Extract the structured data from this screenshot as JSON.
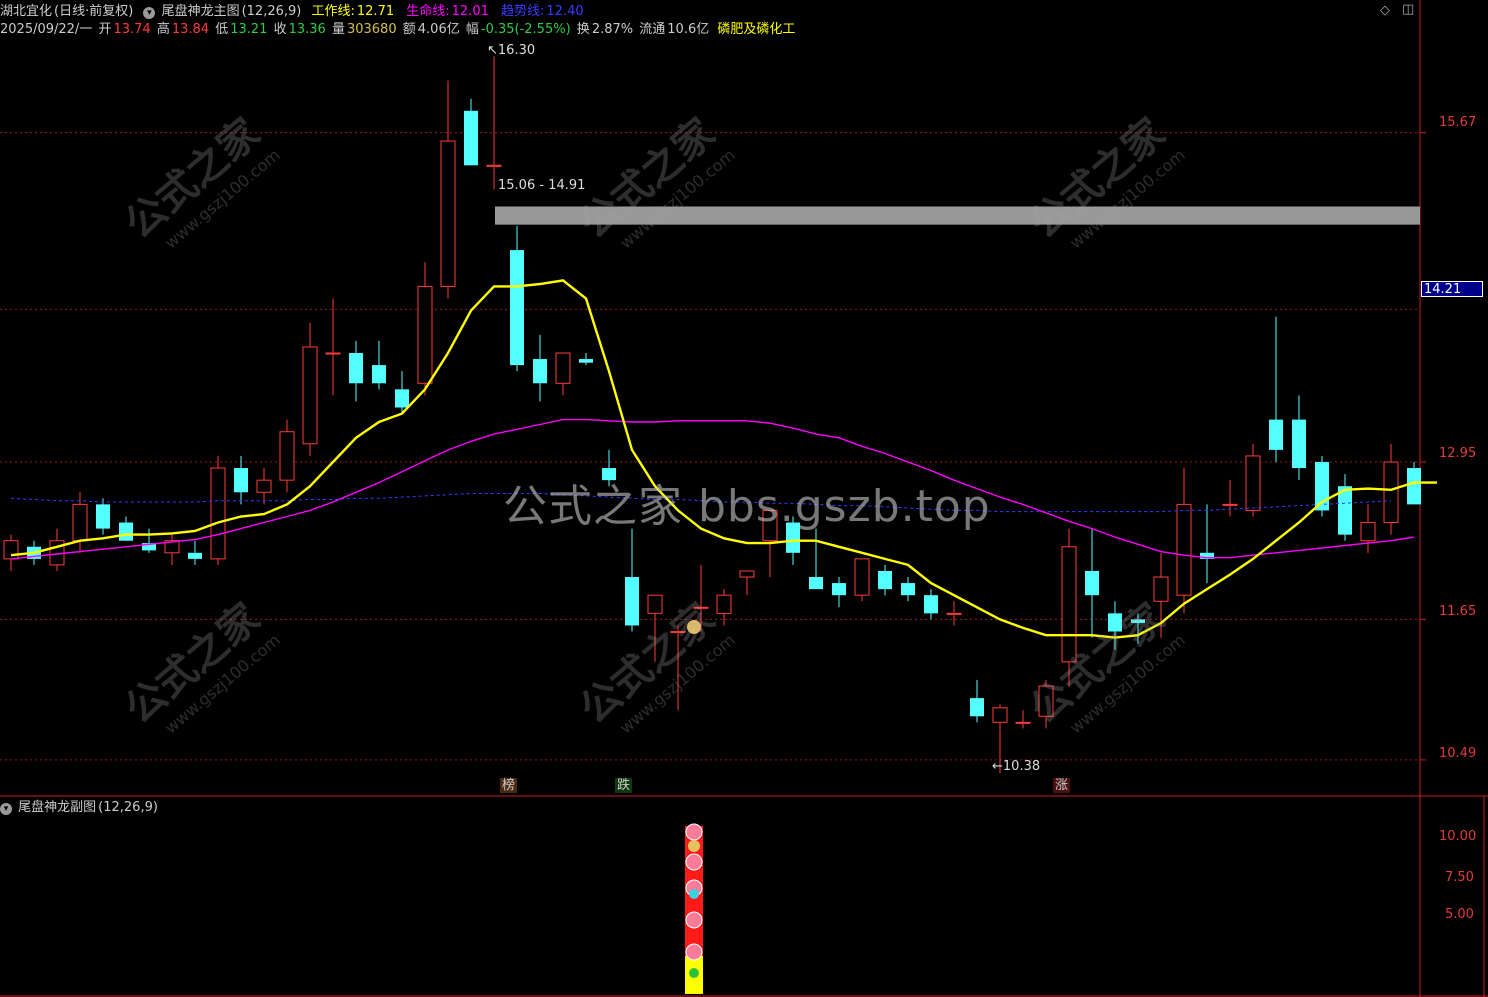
{
  "header": {
    "stock_name": "湖北宜化",
    "period": "(日线·前复权)",
    "indicator_name": "尾盘神龙主图",
    "indicator_params": "(12,26,9)",
    "work_line_label": "工作线:",
    "work_line_value": "12.71",
    "life_line_label": "生命线:",
    "life_line_value": "12.01",
    "trend_line_label": "趋势线:",
    "trend_line_value": "12.40",
    "date": "2025/09/22/一",
    "open_label": "开",
    "open_value": "13.74",
    "high_label": "高",
    "high_value": "13.84",
    "low_label": "低",
    "low_value": "13.21",
    "close_label": "收",
    "close_value": "13.36",
    "volume_label": "量",
    "volume_value": "303680",
    "amount_label": "额",
    "amount_value": "4.06亿",
    "change_label": "幅",
    "change_value": "-0.35(-2.55%)",
    "turnover_label": "换",
    "turnover_value": "2.87%",
    "float_label": "流通",
    "float_value": "10.6亿",
    "sector": "磷肥及磷化工"
  },
  "toolbar": {
    "diamond_icon": "diamond-icon",
    "panel_icon": "panel-toggle-icon"
  },
  "y_axis": {
    "labels": [
      "15.67",
      "12.95",
      "11.65",
      "10.49"
    ],
    "current_price": "14.21"
  },
  "sub_panel": {
    "title": "尾盘神龙副图",
    "params": "(12,26,9)",
    "y_labels": [
      "10.00",
      "7.50",
      "5.00"
    ]
  },
  "annotations": {
    "high_mark": "16.30",
    "low_mark": "10.38",
    "range_label": "15.06 - 14.91"
  },
  "flags": [
    {
      "text": "榜",
      "color": "#d2691e"
    },
    {
      "text": "跌",
      "color": "#2ecc40"
    },
    {
      "text": "涨",
      "color": "#e03c3c"
    }
  ],
  "watermark": {
    "main": "公式之家 bbs.gszb.top",
    "tile_cn": "公式之家",
    "tile_url": "www.gszj100.com"
  },
  "colors": {
    "up": "#ff3b3b",
    "down": "#54ffff",
    "work_line": "#ffff00",
    "life_line": "#ff00ff",
    "trend_line": "#3b3bff",
    "grid": "#a01818",
    "axis": "#c81e1e"
  },
  "chart_data": {
    "type": "candlestick",
    "ylim": [
      10.2,
      16.6
    ],
    "candles": [
      {
        "o": 12.15,
        "h": 12.35,
        "l": 12.05,
        "c": 12.3
      },
      {
        "o": 12.25,
        "h": 12.3,
        "l": 12.1,
        "c": 12.15
      },
      {
        "o": 12.1,
        "h": 12.4,
        "l": 12.05,
        "c": 12.3
      },
      {
        "o": 12.3,
        "h": 12.7,
        "l": 12.2,
        "c": 12.6
      },
      {
        "o": 12.6,
        "h": 12.65,
        "l": 12.35,
        "c": 12.4
      },
      {
        "o": 12.45,
        "h": 12.5,
        "l": 12.3,
        "c": 12.3
      },
      {
        "o": 12.28,
        "h": 12.4,
        "l": 12.2,
        "c": 12.22
      },
      {
        "o": 12.2,
        "h": 12.35,
        "l": 12.1,
        "c": 12.3
      },
      {
        "o": 12.2,
        "h": 12.3,
        "l": 12.1,
        "c": 12.15
      },
      {
        "o": 12.15,
        "h": 13.0,
        "l": 12.1,
        "c": 12.9
      },
      {
        "o": 12.9,
        "h": 13.0,
        "l": 12.6,
        "c": 12.7
      },
      {
        "o": 12.7,
        "h": 12.9,
        "l": 12.6,
        "c": 12.8
      },
      {
        "o": 12.8,
        "h": 13.3,
        "l": 12.7,
        "c": 13.2
      },
      {
        "o": 13.1,
        "h": 14.1,
        "l": 13.0,
        "c": 13.9
      },
      {
        "o": 13.85,
        "h": 14.3,
        "l": 13.5,
        "c": 13.85
      },
      {
        "o": 13.85,
        "h": 13.95,
        "l": 13.45,
        "c": 13.6
      },
      {
        "o": 13.75,
        "h": 13.95,
        "l": 13.55,
        "c": 13.6
      },
      {
        "o": 13.55,
        "h": 13.7,
        "l": 13.35,
        "c": 13.4
      },
      {
        "o": 13.6,
        "h": 14.6,
        "l": 13.5,
        "c": 14.4
      },
      {
        "o": 14.4,
        "h": 16.1,
        "l": 14.3,
        "c": 15.6
      },
      {
        "o": 15.85,
        "h": 15.95,
        "l": 15.4,
        "c": 15.4
      },
      {
        "o": 15.4,
        "h": 16.3,
        "l": 15.2,
        "c": 15.4
      },
      {
        "o": 14.7,
        "h": 14.9,
        "l": 13.7,
        "c": 13.75
      },
      {
        "o": 13.8,
        "h": 14.0,
        "l": 13.45,
        "c": 13.6
      },
      {
        "o": 13.6,
        "h": 13.85,
        "l": 13.5,
        "c": 13.85
      },
      {
        "o": 13.8,
        "h": 13.85,
        "l": 13.75,
        "c": 13.77
      },
      {
        "o": 12.9,
        "h": 13.05,
        "l": 12.75,
        "c": 12.8
      },
      {
        "o": 12.0,
        "h": 12.4,
        "l": 11.55,
        "c": 11.6
      },
      {
        "o": 11.7,
        "h": 11.85,
        "l": 11.3,
        "c": 11.85
      },
      {
        "o": 11.55,
        "h": 11.6,
        "l": 10.9,
        "c": 11.55
      },
      {
        "o": 11.75,
        "h": 12.1,
        "l": 11.55,
        "c": 11.75
      },
      {
        "o": 11.7,
        "h": 11.9,
        "l": 11.6,
        "c": 11.85
      },
      {
        "o": 12.0,
        "h": 12.05,
        "l": 11.85,
        "c": 12.05
      },
      {
        "o": 12.3,
        "h": 12.55,
        "l": 12.0,
        "c": 12.55
      },
      {
        "o": 12.45,
        "h": 12.5,
        "l": 12.1,
        "c": 12.2
      },
      {
        "o": 12.0,
        "h": 12.4,
        "l": 11.95,
        "c": 11.9
      },
      {
        "o": 11.95,
        "h": 12.0,
        "l": 11.75,
        "c": 11.85
      },
      {
        "o": 11.85,
        "h": 12.15,
        "l": 11.8,
        "c": 12.15
      },
      {
        "o": 12.05,
        "h": 12.1,
        "l": 11.85,
        "c": 11.9
      },
      {
        "o": 11.95,
        "h": 12.0,
        "l": 11.8,
        "c": 11.85
      },
      {
        "o": 11.85,
        "h": 11.9,
        "l": 11.65,
        "c": 11.7
      },
      {
        "o": 11.7,
        "h": 11.8,
        "l": 11.6,
        "c": 11.7
      },
      {
        "o": 11.0,
        "h": 11.15,
        "l": 10.8,
        "c": 10.85
      },
      {
        "o": 10.8,
        "h": 10.95,
        "l": 10.38,
        "c": 10.92
      },
      {
        "o": 10.8,
        "h": 10.9,
        "l": 10.75,
        "c": 10.8
      },
      {
        "o": 10.85,
        "h": 11.15,
        "l": 10.75,
        "c": 11.1
      },
      {
        "o": 11.3,
        "h": 12.4,
        "l": 11.1,
        "c": 12.25
      },
      {
        "o": 12.05,
        "h": 12.4,
        "l": 11.5,
        "c": 11.85
      },
      {
        "o": 11.7,
        "h": 11.8,
        "l": 11.4,
        "c": 11.55
      },
      {
        "o": 11.65,
        "h": 11.7,
        "l": 11.45,
        "c": 11.62
      },
      {
        "o": 11.8,
        "h": 12.2,
        "l": 11.5,
        "c": 12.0
      },
      {
        "o": 11.85,
        "h": 12.9,
        "l": 11.7,
        "c": 12.6
      },
      {
        "o": 12.2,
        "h": 12.6,
        "l": 11.95,
        "c": 12.15
      },
      {
        "o": 12.6,
        "h": 12.8,
        "l": 12.5,
        "c": 12.6
      },
      {
        "o": 12.55,
        "h": 13.1,
        "l": 12.5,
        "c": 13.0
      },
      {
        "o": 13.3,
        "h": 14.15,
        "l": 12.95,
        "c": 13.05
      },
      {
        "o": 13.3,
        "h": 13.5,
        "l": 12.8,
        "c": 12.9
      },
      {
        "o": 12.95,
        "h": 13.0,
        "l": 12.5,
        "c": 12.55
      },
      {
        "o": 12.75,
        "h": 12.85,
        "l": 12.3,
        "c": 12.35
      },
      {
        "o": 12.3,
        "h": 12.6,
        "l": 12.2,
        "c": 12.45
      },
      {
        "o": 12.45,
        "h": 13.1,
        "l": 12.35,
        "c": 12.95
      },
      {
        "o": 12.9,
        "h": 12.95,
        "l": 12.6,
        "c": 12.6
      }
    ],
    "work_line": [
      12.18,
      12.2,
      12.25,
      12.3,
      12.32,
      12.35,
      12.35,
      12.36,
      12.38,
      12.45,
      12.5,
      12.52,
      12.6,
      12.75,
      12.95,
      13.15,
      13.28,
      13.35,
      13.55,
      13.85,
      14.2,
      14.4,
      14.4,
      14.42,
      14.45,
      14.3,
      13.7,
      13.05,
      12.75,
      12.55,
      12.4,
      12.32,
      12.28,
      12.28,
      12.3,
      12.3,
      12.25,
      12.2,
      12.15,
      12.1,
      11.95,
      11.85,
      11.75,
      11.65,
      11.58,
      11.52,
      11.52,
      11.52,
      11.5,
      11.52,
      11.62,
      11.78,
      11.9,
      12.02,
      12.15,
      12.3,
      12.45,
      12.62,
      12.72,
      12.73,
      12.72,
      12.78,
      12.78
    ],
    "life_line": [
      12.15,
      12.17,
      12.19,
      12.21,
      12.23,
      12.25,
      12.27,
      12.29,
      12.31,
      12.35,
      12.4,
      12.45,
      12.5,
      12.55,
      12.62,
      12.7,
      12.78,
      12.87,
      12.96,
      13.05,
      13.12,
      13.18,
      13.22,
      13.26,
      13.3,
      13.3,
      13.29,
      13.28,
      13.28,
      13.29,
      13.29,
      13.29,
      13.29,
      13.27,
      13.23,
      13.18,
      13.15,
      13.08,
      13.02,
      12.95,
      12.88,
      12.8,
      12.73,
      12.66,
      12.6,
      12.53,
      12.46,
      12.4,
      12.33,
      12.27,
      12.21,
      12.18,
      12.16,
      12.16,
      12.18,
      12.2,
      12.22,
      12.24,
      12.26,
      12.28,
      12.3,
      12.33
    ],
    "trend_line": [
      12.65,
      12.64,
      12.63,
      12.63,
      12.62,
      12.62,
      12.62,
      12.62,
      12.62,
      12.63,
      12.63,
      12.63,
      12.63,
      12.64,
      12.64,
      12.65,
      12.65,
      12.66,
      12.67,
      12.68,
      12.69,
      12.69,
      12.69,
      12.69,
      12.68,
      12.67,
      12.66,
      12.65,
      12.64,
      12.64,
      12.63,
      12.62,
      12.62,
      12.61,
      12.61,
      12.6,
      12.59,
      12.59,
      12.58,
      12.57,
      12.56,
      12.55,
      12.55,
      12.54,
      12.54,
      12.54,
      12.54,
      12.54,
      12.54,
      12.54,
      12.54,
      12.55,
      12.55,
      12.56,
      12.57,
      12.58,
      12.59,
      12.6,
      12.61,
      12.62,
      12.63
    ]
  }
}
